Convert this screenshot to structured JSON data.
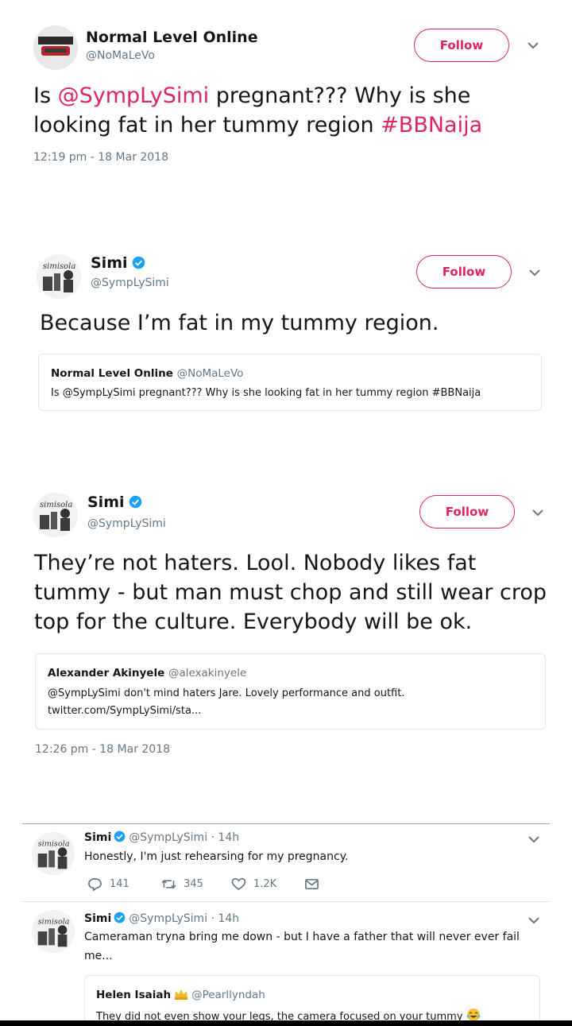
{
  "tweet1": {
    "name": "Normal Level Online",
    "handle": "@NoMaLeVo",
    "follow": "Follow",
    "text_pre": "Is ",
    "mention": "@SympLySimi",
    "text_mid": " pregnant???  Why is she looking fat in her tummy region ",
    "hashtag": "#BBNaija",
    "timestamp": "12:19 pm - 18 Mar 2018"
  },
  "tweet2": {
    "name": "Simi",
    "handle": "@SympLySimi",
    "follow": "Follow",
    "text": "Because I’m fat in my tummy region.",
    "quote": {
      "name": "Normal Level Online",
      "handle": "@NoMaLeVo",
      "text": "Is @SympLySimi pregnant???  Why is she looking fat in her tummy region #BBNaija"
    }
  },
  "tweet3": {
    "name": "Simi",
    "handle": "@SympLySimi",
    "follow": "Follow",
    "text": "They’re not haters. Lool. Nobody likes fat tummy - but man must chop and still wear crop top for the culture. Everybody will be ok.",
    "quote": {
      "name": "Alexander Akinyele",
      "handle": "@alexakinyele",
      "line1": "@SympLySimi don't mind haters Jare.  Lovely performance and outfit.",
      "line2": "twitter.com/SympLySimi/sta..."
    },
    "timestamp": "12:26 pm - 18 Mar 2018"
  },
  "tweet4": {
    "name": "Simi",
    "meta": "@SympLySimi · 14h",
    "text": "Honestly, I'm just rehearsing for my pregnancy.",
    "replies": "141",
    "retweets": "345",
    "likes": "1.2K"
  },
  "tweet5": {
    "name": "Simi",
    "meta": "@SympLySimi · 14h",
    "text": "Cameraman tryna bring me down - but I have a father that will never ever fail me...",
    "quote": {
      "name": "Helen Isaiah",
      "handle": "@Pearllyndah",
      "text": "They did not even show your legs, the camera focused on your tummy"
    }
  },
  "colors": {
    "accent": "#e0245e",
    "verified": "#1da1f2",
    "secondary_text": "#657786"
  },
  "icons": {
    "reply": "reply-icon",
    "retweet": "retweet-icon",
    "like": "heart-icon",
    "dm": "envelope-icon",
    "verified": "verified-badge-icon",
    "chevron": "chevron-down-icon"
  }
}
